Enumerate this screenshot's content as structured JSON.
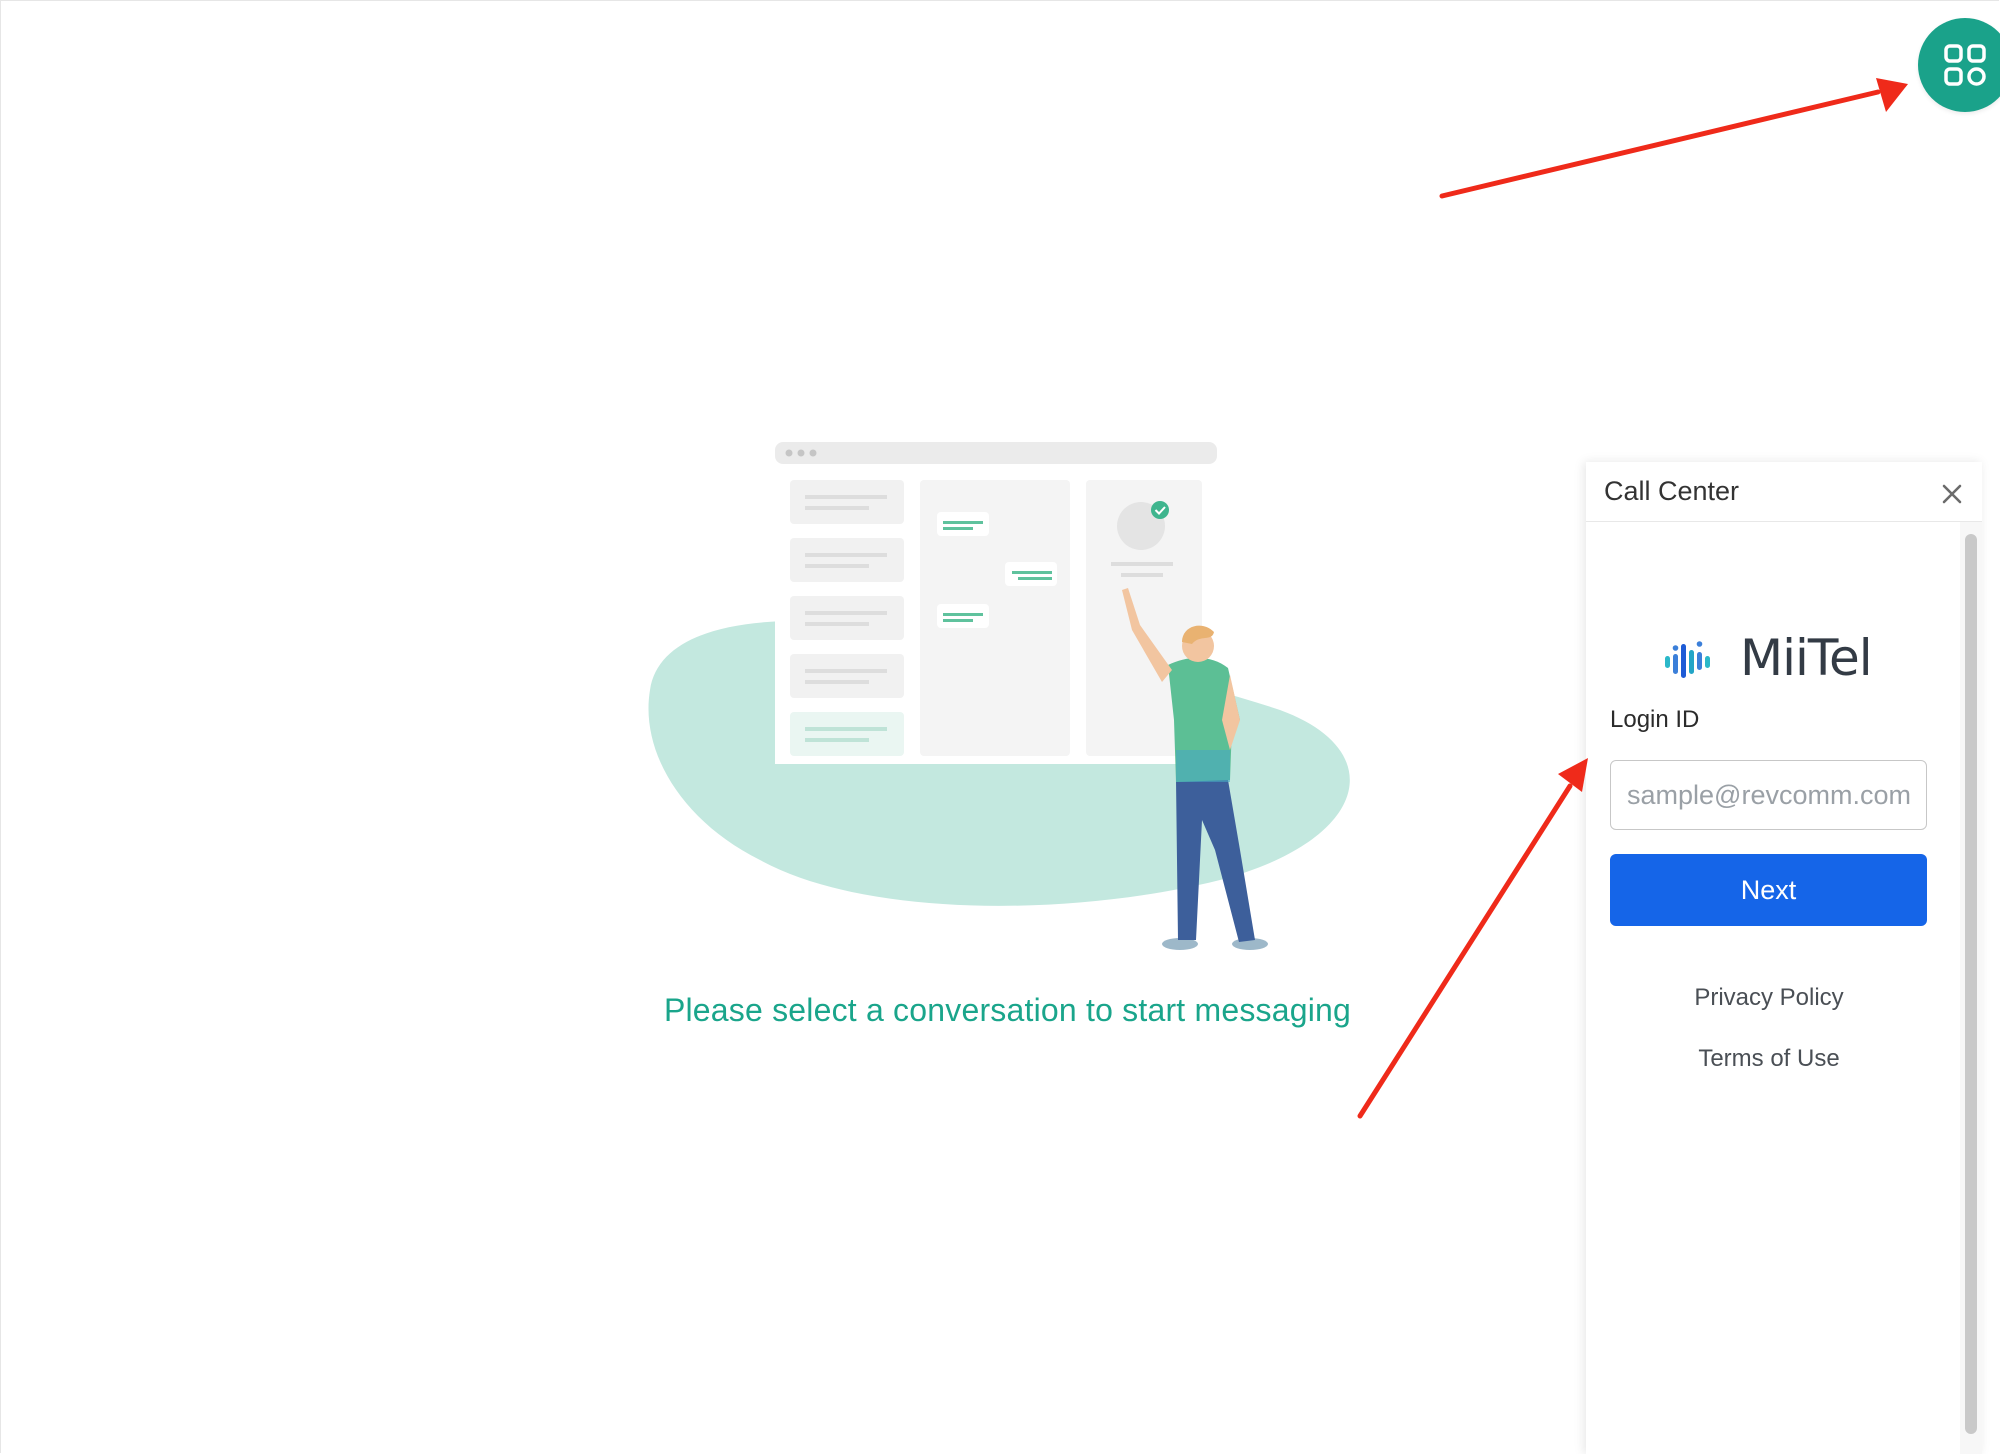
{
  "apps_button": {
    "icon": "apps-grid-icon",
    "color": "#1aa28a"
  },
  "empty_state": {
    "illustration": "conversation-board-illustration",
    "message": "Please select a conversation to start messaging",
    "accent_color": "#1aa58b"
  },
  "call_center": {
    "title": "Call Center",
    "close_icon": "close-icon",
    "logo_text": "MiiTel",
    "login_label": "Login ID",
    "login_placeholder": "sample@revcomm.com",
    "next_label": "Next",
    "next_color": "#1565e8",
    "privacy_label": "Privacy Policy",
    "terms_label": "Terms of Use"
  },
  "annotations": {
    "arrow_color": "#ef2a1a"
  }
}
